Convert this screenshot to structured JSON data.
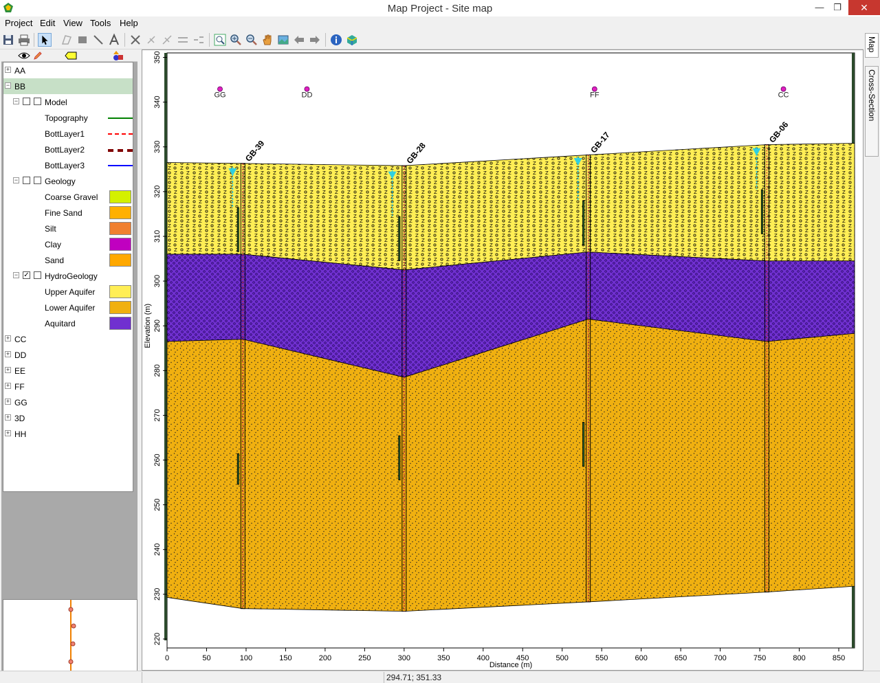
{
  "window": {
    "title": "Map Project - Site map"
  },
  "menu": [
    "Project",
    "Edit",
    "View",
    "Tools",
    "Help"
  ],
  "tabs": {
    "map": "Map",
    "cross_section": "Cross-Section"
  },
  "status": {
    "coords": "294.71; 351.33"
  },
  "tree": [
    {
      "label": "AA",
      "kind": "group",
      "expanded": false
    },
    {
      "label": "BB",
      "kind": "group",
      "expanded": true,
      "selected": true
    },
    {
      "label": "Model",
      "kind": "folder"
    },
    {
      "label": "Topography",
      "kind": "line",
      "color": "#008000",
      "style": "solid"
    },
    {
      "label": "BottLayer1",
      "kind": "line",
      "color": "#ff0000",
      "style": "dashed"
    },
    {
      "label": "BottLayer2",
      "kind": "line",
      "color": "#800000",
      "style": "dashed-thick"
    },
    {
      "label": "BottLayer3",
      "kind": "line",
      "color": "#0000ff",
      "style": "solid"
    },
    {
      "label": "Geology",
      "kind": "folder"
    },
    {
      "label": "Coarse Gravel",
      "kind": "swatch",
      "color": "#d4f000"
    },
    {
      "label": "Fine Sand",
      "kind": "swatch",
      "color": "#ffb000"
    },
    {
      "label": "Silt",
      "kind": "swatch",
      "color": "#f08030"
    },
    {
      "label": "Clay",
      "kind": "swatch",
      "color": "#c000c0"
    },
    {
      "label": "Sand",
      "kind": "swatch",
      "color": "#ffa800"
    },
    {
      "label": "HydroGeology",
      "kind": "folder",
      "checked": true
    },
    {
      "label": "Upper Aquifer",
      "kind": "swatch",
      "color": "#ffee55"
    },
    {
      "label": "Lower Aquifer",
      "kind": "swatch",
      "color": "#f0b010"
    },
    {
      "label": "Aquitard",
      "kind": "swatch",
      "color": "#7030d0"
    },
    {
      "label": "CC",
      "kind": "group",
      "expanded": false
    },
    {
      "label": "DD",
      "kind": "group",
      "expanded": false
    },
    {
      "label": "EE",
      "kind": "group",
      "expanded": false
    },
    {
      "label": "FF",
      "kind": "group",
      "expanded": false
    },
    {
      "label": "GG",
      "kind": "group",
      "expanded": false
    },
    {
      "label": "3D",
      "kind": "group",
      "expanded": false
    },
    {
      "label": "HH",
      "kind": "group",
      "expanded": false
    }
  ],
  "chart_data": {
    "type": "cross-section",
    "xlabel": "Distance (m)",
    "ylabel": "Elevation (m)",
    "xlim": [
      0,
      870
    ],
    "ylim": [
      218,
      351
    ],
    "xticks": [
      0,
      50,
      100,
      150,
      200,
      250,
      300,
      350,
      400,
      450,
      500,
      550,
      600,
      650,
      700,
      750,
      800,
      850
    ],
    "yticks": [
      220,
      230,
      240,
      250,
      260,
      270,
      280,
      290,
      300,
      310,
      320,
      330,
      340,
      350
    ],
    "colors": {
      "upper_aquifer": "#ffee55",
      "aquitard": "#7030d0",
      "lower_aquifer": "#f0b010"
    },
    "surfaces": {
      "top": [
        [
          0,
          326.5
        ],
        [
          96,
          326.3
        ],
        [
          300,
          325.8
        ],
        [
          533,
          328.2
        ],
        [
          759,
          330.5
        ],
        [
          870,
          330.8
        ]
      ],
      "upper_bottom": [
        [
          0,
          306
        ],
        [
          96,
          306
        ],
        [
          300,
          302.5
        ],
        [
          533,
          306.5
        ],
        [
          759,
          304.5
        ],
        [
          870,
          304.5
        ]
      ],
      "aquitard_bottom": [
        [
          0,
          286.5
        ],
        [
          96,
          287
        ],
        [
          300,
          278.5
        ],
        [
          533,
          291.5
        ],
        [
          759,
          286.5
        ],
        [
          870,
          288.3
        ]
      ],
      "base": [
        [
          0,
          229.3
        ],
        [
          96,
          226.8
        ],
        [
          300,
          226.2
        ],
        [
          533,
          228.3
        ],
        [
          759,
          230.5
        ],
        [
          870,
          231.8
        ]
      ]
    },
    "wells": [
      {
        "name": "GB-39",
        "x": 96,
        "top": 326.3,
        "bottom": 226.8,
        "water_x": 83,
        "water_y": 325.5,
        "screens": [
          [
            316.5,
            306.5
          ],
          [
            261.5,
            254.5
          ]
        ]
      },
      {
        "name": "GB-28",
        "x": 300,
        "top": 325.8,
        "bottom": 226.2,
        "water_x": 285,
        "water_y": 324.8,
        "screens": [
          [
            314.5,
            304.5
          ],
          [
            265.5,
            255.5
          ]
        ]
      },
      {
        "name": "GB-17",
        "x": 533,
        "top": 328.2,
        "bottom": 228.3,
        "water_x": 520,
        "water_y": 327.8,
        "screens": [
          [
            318,
            308
          ],
          [
            268.5,
            258.5
          ]
        ]
      },
      {
        "name": "GB-06",
        "x": 759,
        "top": 330.5,
        "bottom": 230.5,
        "water_x": 746,
        "water_y": 330.0,
        "screens": [
          [
            320.5,
            310.5
          ]
        ]
      }
    ],
    "section_markers": [
      {
        "label": "GG",
        "x": 67
      },
      {
        "label": "DD",
        "x": 177
      },
      {
        "label": "FF",
        "x": 541
      },
      {
        "label": "CC",
        "x": 780
      }
    ],
    "marker_elevation": 342
  }
}
